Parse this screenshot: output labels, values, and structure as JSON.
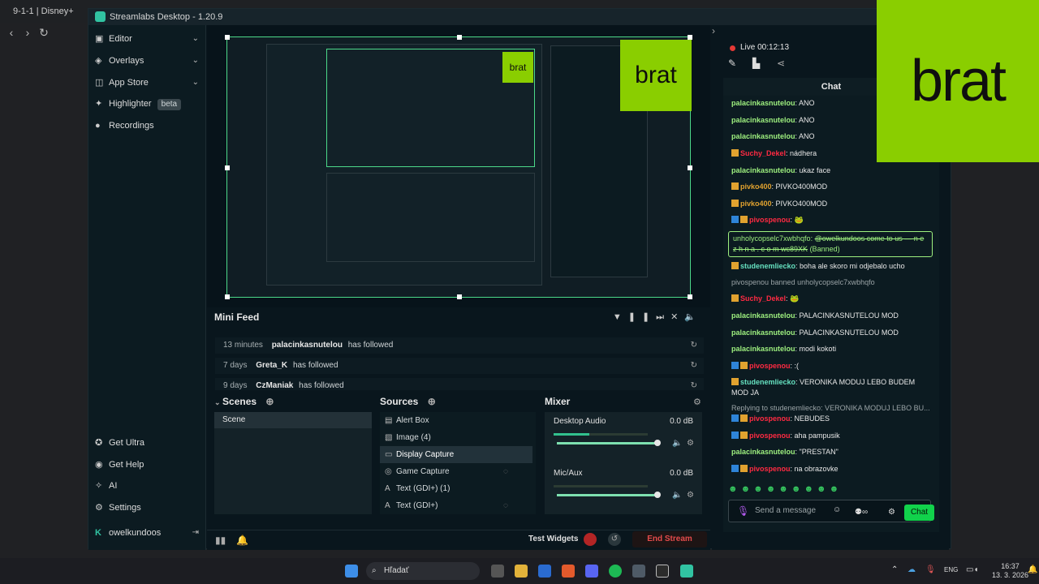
{
  "browser": {
    "tab_title": "9-1-1 | Disney+"
  },
  "app": {
    "title": "Streamlabs Desktop - 1.20.9"
  },
  "sidebar": {
    "items": [
      {
        "label": "Editor",
        "icon": "editor-icon",
        "expandable": true
      },
      {
        "label": "Overlays",
        "icon": "overlays-icon",
        "expandable": true
      },
      {
        "label": "App Store",
        "icon": "app-store-icon",
        "expandable": true
      },
      {
        "label": "Highlighter",
        "icon": "highlighter-icon",
        "badge": "beta"
      },
      {
        "label": "Recordings",
        "icon": "recordings-icon"
      }
    ],
    "bottom_items": [
      {
        "label": "Get Ultra",
        "icon": "ultra-icon"
      },
      {
        "label": "Get Help",
        "icon": "help-icon"
      },
      {
        "label": "AI",
        "icon": "ai-icon"
      },
      {
        "label": "Settings",
        "icon": "gear-icon"
      }
    ],
    "user": "owelkundoos"
  },
  "preview": {
    "overlay_text": "brat"
  },
  "mini_feed": {
    "title": "Mini Feed",
    "rows": [
      {
        "time": "13 minutes",
        "name": "palacinkasnutelou",
        "action": "has followed"
      },
      {
        "time": "7 days",
        "name": "Greta_K",
        "action": "has followed"
      },
      {
        "time": "9 days",
        "name": "CzManiak",
        "action": "has followed"
      }
    ]
  },
  "scenes": {
    "title": "Scenes",
    "items": [
      "Scene"
    ]
  },
  "sources": {
    "title": "Sources",
    "items": [
      {
        "label": "Alert Box",
        "icon": "alert-box-icon"
      },
      {
        "label": "Image (4)",
        "icon": "image-icon"
      },
      {
        "label": "Display Capture",
        "icon": "monitor-icon",
        "selected": true
      },
      {
        "label": "Game Capture",
        "icon": "gamepad-icon",
        "hidden": true
      },
      {
        "label": "Text (GDI+) (1)",
        "icon": "text-icon"
      },
      {
        "label": "Text (GDI+)",
        "icon": "text-icon",
        "hidden": true
      }
    ]
  },
  "mixer": {
    "title": "Mixer",
    "channels": [
      {
        "label": "Desktop Audio",
        "db": "0.0 dB",
        "level": 0.38
      },
      {
        "label": "Mic/Aux",
        "db": "0.0 dB",
        "level": 0.0
      }
    ]
  },
  "footer": {
    "test_widgets": "Test Widgets",
    "end_stream": "End Stream"
  },
  "live": {
    "label": "Live 00:12:13"
  },
  "chat": {
    "header": "Chat",
    "messages": [
      {
        "name": "palacinkasnutelou",
        "color": "#9ef07f",
        "text": "ANO"
      },
      {
        "name": "palacinkasnutelou",
        "color": "#9ef07f",
        "text": "ANO"
      },
      {
        "name": "palacinkasnutelou",
        "color": "#9ef07f",
        "text": "ANO"
      },
      {
        "name": "Suchy_Dekel",
        "color": "#ff2a42",
        "text": "nádhera",
        "badges": [
          "gold"
        ]
      },
      {
        "name": "palacinkasnutelou",
        "color": "#9ef07f",
        "text": "ukaz face"
      },
      {
        "name": "pivko400",
        "color": "#e1a22f",
        "text": "PIVKO400MOD",
        "badges": [
          "gold"
        ]
      },
      {
        "name": "pivko400",
        "color": "#e1a22f",
        "text": "PIVKO400MOD",
        "badges": [
          "gold"
        ]
      },
      {
        "name": "pivospenou",
        "color": "#ff2a42",
        "text": "🐸",
        "badges": [
          "blue",
          "gold"
        ]
      }
    ],
    "banned_message": {
      "name": "unholycopselc7xwbhqfo",
      "text": "@owelkundoos come to us — n e z h n a . c o m wc89XK",
      "tag": "(Banned)"
    },
    "messages_after": [
      {
        "name": "studenemliecko",
        "color": "#66e1c0",
        "text": "boha ale skoro mi odjebalo ucho",
        "badges": [
          "gold"
        ]
      },
      {
        "system": true,
        "text": "pivospenou banned unholycopselc7xwbhqfo"
      },
      {
        "name": "Suchy_Dekel",
        "color": "#ff2a42",
        "text": "🐸",
        "badges": [
          "gold"
        ]
      },
      {
        "name": "palacinkasnutelou",
        "color": "#9ef07f",
        "text": "PALACINKASNUTELOU MOD"
      },
      {
        "name": "palacinkasnutelou",
        "color": "#9ef07f",
        "text": "PALACINKASNUTELOU MOD"
      },
      {
        "name": "palacinkasnutelou",
        "color": "#9ef07f",
        "text": "modi kokoti"
      },
      {
        "name": "pivospenou",
        "color": "#ff2a42",
        "text": ":(",
        "badges": [
          "blue",
          "gold"
        ]
      },
      {
        "name": "studenemliecko",
        "color": "#66e1c0",
        "text": "VERONIKA MODUJ LEBO BUDEM MOD JA",
        "badges": [
          "gold"
        ]
      },
      {
        "reply": true,
        "text": "Replying to studenemliecko: VERONIKA MODUJ LEBO BU..."
      },
      {
        "name": "pivospenou",
        "color": "#ff2a42",
        "text": "NEBUDES",
        "badges": [
          "blue",
          "gold"
        ]
      },
      {
        "name": "pivospenou",
        "color": "#ff2a42",
        "text": "aha pampusik",
        "badges": [
          "blue",
          "gold"
        ]
      },
      {
        "name": "palacinkasnutelou",
        "color": "#9ef07f",
        "text": "\"PRESTAN\""
      },
      {
        "name": "pivospenou",
        "color": "#ff2a42",
        "text": "na obrazovke",
        "badges": [
          "blue",
          "gold"
        ]
      }
    ],
    "input_placeholder": "Send a message",
    "send_label": "Chat"
  },
  "brat_overlay": "brat",
  "taskbar": {
    "search": "Hľadať",
    "lang": "ENG",
    "time": "16:37",
    "date": "13. 3. 2026"
  }
}
